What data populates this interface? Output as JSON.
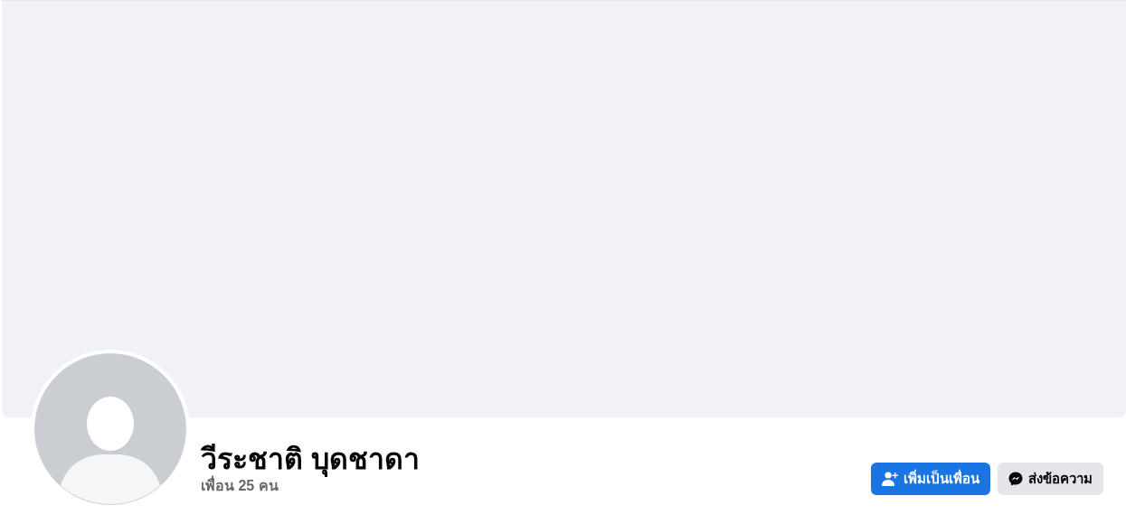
{
  "profile": {
    "name": "วีระชาติ บุดชาดา",
    "friends": "เพื่อน 25 คน"
  },
  "buttons": [
    {
      "label": "เพิ่มเป็นเพื่อน",
      "kind": "primary"
    },
    {
      "label": "ส่งข้อความ",
      "kind": "secondary"
    }
  ]
}
